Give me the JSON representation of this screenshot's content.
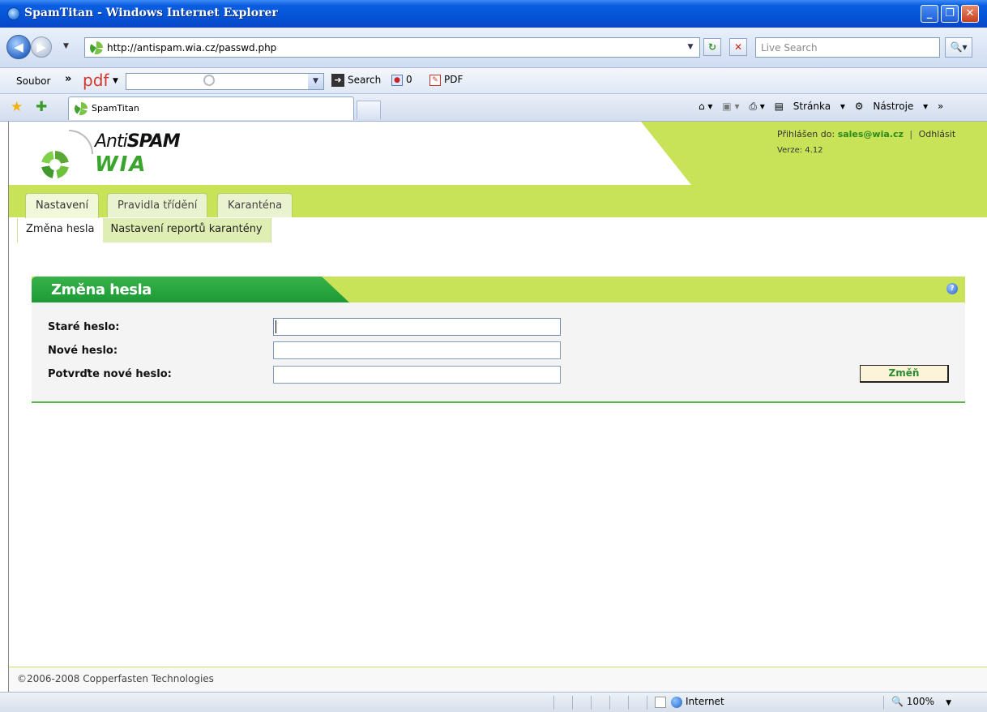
{
  "browser": {
    "window_title": "SpamTitan - Windows Internet Explorer",
    "url": "http://antispam.wia.cz/passwd.php",
    "search_placeholder": "Live Search",
    "menu_soubor": "Soubor",
    "pdf_label": "pdf",
    "toolbar_search_label": "Search",
    "toolbar_count": "0",
    "toolbar_pdf_label": "PDF",
    "tab_title": "SpamTitan",
    "stranka_label": "Stránka",
    "nastroje_label": "Nástroje",
    "status_zone": "Internet",
    "zoom": "100%"
  },
  "header": {
    "logo_anti": "Anti",
    "logo_spam": "SPAM",
    "logo_wia": "WIA",
    "logged_in_label": "Přihlášen do:",
    "user": "sales@wia.cz",
    "separator": "|",
    "logout": "Odhlásit",
    "version": "Verze: 4.12"
  },
  "nav": {
    "tabs": [
      "Nastavení",
      "Pravidla třídění",
      "Karanténa"
    ],
    "subtabs": [
      "Změna hesla",
      "Nastavení reportů karantény"
    ]
  },
  "panel": {
    "title": "Změna hesla",
    "fields": [
      {
        "label": "Staré heslo:",
        "value": ""
      },
      {
        "label": "Nové heslo:",
        "value": ""
      },
      {
        "label": "Potvrďte nové heslo:",
        "value": ""
      }
    ],
    "submit_label": "Změň"
  },
  "footer": {
    "copyright": "©2006-2008 Copperfasten Technologies"
  },
  "colors": {
    "brand_green": "#c9e359",
    "title_green": "#1c9a35",
    "link_green": "#2a8a1c"
  }
}
